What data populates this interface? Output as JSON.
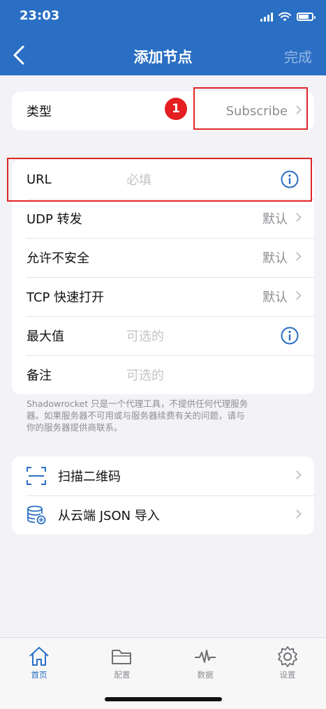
{
  "status_bar": {
    "time": "23:03"
  },
  "nav": {
    "title": "添加节点",
    "done_label": "完成"
  },
  "type_row": {
    "label": "类型",
    "value": "Subscribe"
  },
  "annotation": {
    "badge_number": "1"
  },
  "form_rows": [
    {
      "label": "URL",
      "placeholder": "必填"
    },
    {
      "label": "UDP 转发",
      "value": "默认"
    },
    {
      "label": "允许不安全",
      "value": "默认"
    },
    {
      "label": "TCP 快速打开",
      "value": "默认"
    },
    {
      "label": "最大值",
      "placeholder": "可选的"
    },
    {
      "label": "备注",
      "placeholder": "可选的"
    }
  ],
  "footnote": {
    "line1": "Shadowrocket 只是一个代理工具，不提供任何代理服务",
    "line2": "器。如果服务器不可用或与服务器续费有关的问题，请与",
    "line3": "你的服务器提供商联系。"
  },
  "actions": [
    {
      "label": "扫描二维码",
      "icon": "qr-scan-icon"
    },
    {
      "label": "从云端 JSON 导入",
      "icon": "cloud-database-import-icon"
    }
  ],
  "tabs": [
    {
      "label": "首页",
      "icon": "home-icon",
      "active": true
    },
    {
      "label": "配置",
      "icon": "folder-icon",
      "active": false
    },
    {
      "label": "数据",
      "icon": "activity-icon",
      "active": false
    },
    {
      "label": "设置",
      "icon": "gear-icon",
      "active": false
    }
  ],
  "colors": {
    "accent": "#2a6fc4",
    "annotation_red": "#e02424",
    "background": "#f2f2f7"
  }
}
